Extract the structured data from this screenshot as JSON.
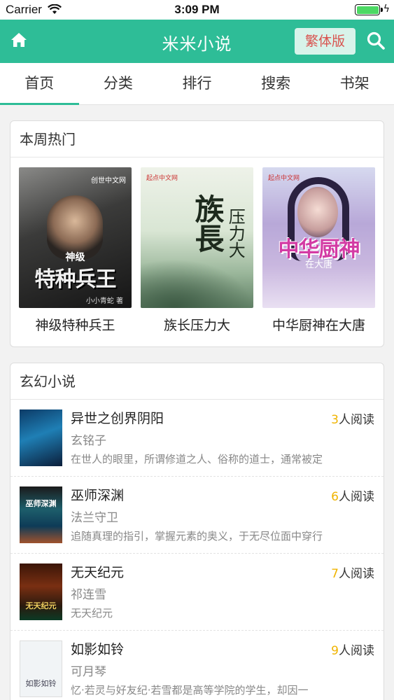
{
  "status_bar": {
    "carrier": "Carrier",
    "time": "3:09 PM",
    "battery_level": 1.0,
    "charging": true
  },
  "app_bar": {
    "title": "米米小说",
    "traditional_button": "繁体版",
    "home_icon": "home-icon",
    "search_icon": "search-icon",
    "bar_color": "#2ebd97"
  },
  "tabs": [
    {
      "label": "首页",
      "active": true
    },
    {
      "label": "分类",
      "active": false
    },
    {
      "label": "排行",
      "active": false
    },
    {
      "label": "搜索",
      "active": false
    },
    {
      "label": "书架",
      "active": false
    }
  ],
  "hot_section": {
    "title": "本周热门",
    "books": [
      {
        "name": "神级特种兵王",
        "cover_text": "特种兵王",
        "cover_small": "神级",
        "cover_logo": "创世中文网",
        "cover_author": "小小青蛇 著"
      },
      {
        "name": "族长压力大",
        "cover_big": "族長",
        "cover_small": "压力大",
        "cover_pub": "起点中文网"
      },
      {
        "name": "中华厨神在大唐",
        "cover_big": "中华厨神",
        "cover_sub": "在大唐",
        "cover_pub": "起点中文网"
      }
    ]
  },
  "fantasy_section": {
    "title": "玄幻小说",
    "reads_suffix": "人阅读",
    "items": [
      {
        "title": "异世之创界阴阳",
        "author": "玄铭子",
        "reads": "3",
        "desc": "在世人的眼里，所谓修道之人、俗称的道士，通常被定"
      },
      {
        "title": "巫师深渊",
        "author": "法兰守卫",
        "reads": "6",
        "desc": "追随真理的指引，掌握元素的奥义，于无尽位面中穿行",
        "cover_text": "巫师深渊"
      },
      {
        "title": "无天纪元",
        "author": "祁连雪",
        "reads": "7",
        "desc": "无天纪元",
        "cover_text": "无天纪元"
      },
      {
        "title": "如影如铃",
        "author": "可月琴",
        "reads": "9",
        "desc": "忆·若灵与好友纪·若雪都是高等学院的学生，却因一",
        "cover_text": "如影如铃"
      }
    ]
  }
}
